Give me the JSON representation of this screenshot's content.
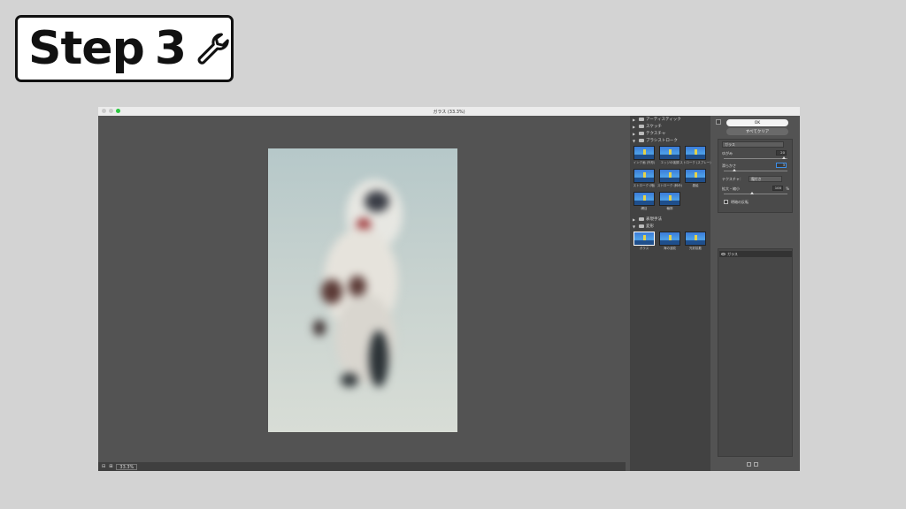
{
  "step": {
    "word": "Step",
    "number": "3",
    "icon": "wrench-icon"
  },
  "window": {
    "title": "ガラス (33.3%)",
    "zoom": "33.3%"
  },
  "gallery": {
    "folders": [
      {
        "label": "アーティスティック",
        "expanded": false
      },
      {
        "label": "スケッチ",
        "expanded": false
      },
      {
        "label": "テクスチャ",
        "expanded": false
      },
      {
        "label": "ブラシストローク",
        "expanded": true
      },
      {
        "label": "表現手法",
        "expanded": false
      },
      {
        "label": "変形",
        "expanded": true
      }
    ],
    "brush_thumbs": [
      "インク画 (外形)",
      "エッジの強調",
      "ストローク (スプレー)",
      "ストローク (暗)",
      "ストローク (斜め)",
      "墨絵",
      "網目",
      "輪郭"
    ],
    "distort_thumbs": [
      "ガラス",
      "海の波紋",
      "光彩拡散"
    ]
  },
  "settings": {
    "ok_label": "OK",
    "clear_label": "すべてクリア",
    "filter_select": "ガラス",
    "distortion_label": "ゆがみ",
    "distortion_value": "20",
    "smoothness_label": "滑らかさ",
    "smoothness_value": "3",
    "texture_label": "テクスチャ：",
    "texture_value": "霜付き",
    "scale_label": "拡大・縮小",
    "scale_value": "100",
    "scale_unit": "%",
    "invert_label": "明暗の反転",
    "layer_label": "ガラス"
  },
  "colors": {
    "window_bg": "#535353",
    "gallery_bg": "#424242",
    "accent": "#2bc840"
  }
}
